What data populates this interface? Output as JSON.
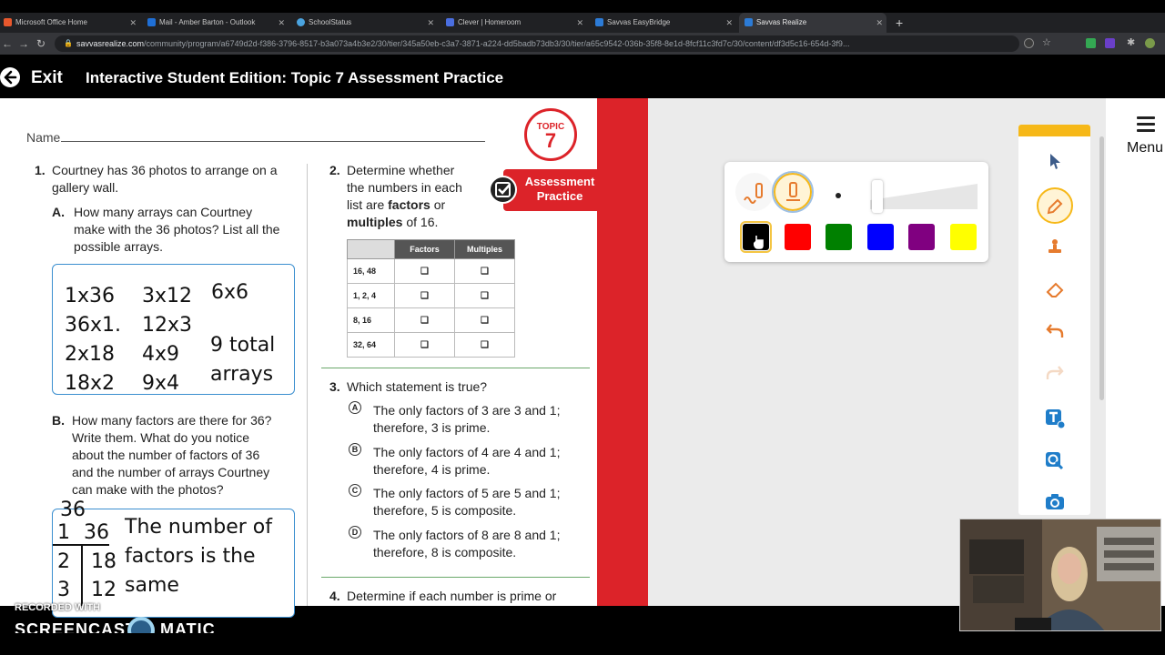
{
  "browser": {
    "tabs": [
      {
        "label": "Microsoft Office Home",
        "color": "#e8582d",
        "active": false
      },
      {
        "label": "Mail - Amber Barton - Outlook",
        "color": "#1f6fd6",
        "active": false
      },
      {
        "label": "SchoolStatus",
        "color": "#4aa3df",
        "active": false
      },
      {
        "label": "Clever | Homeroom",
        "color": "#4a6ee0",
        "active": false
      },
      {
        "label": "Savvas EasyBridge",
        "color": "#2c7bd6",
        "active": false
      },
      {
        "label": "Savvas Realize",
        "color": "#2c7bd6",
        "active": true
      }
    ],
    "new_tab": "+",
    "url_host": "savvasrealize.com",
    "url_path": "/community/program/a6749d2d-f386-3796-8517-b3a073a4b3e2/30/tier/345a50eb-c3a7-3871-a224-dd5badb73db3/30/tier/a65c9542-036b-35f8-8e1d-8fcf11c3fd7c/30/content/df3d5c16-654d-3f9..."
  },
  "header": {
    "exit_label": "Exit",
    "title": "Interactive Student Edition: Topic 7 Assessment Practice"
  },
  "doc": {
    "name_label": "Name",
    "topic_label": "TOPIC",
    "topic_number": "7",
    "assessment_line1": "Assessment",
    "assessment_line2": "Practice",
    "q1": {
      "number": "1.",
      "stem_line1": "Courtney has 36 photos to arrange on a",
      "stem_line2": "gallery wall.",
      "a_label": "A.",
      "a_line1": "How many arrays can Courtney",
      "a_line2": "make with the 36 photos? List all the",
      "a_line3": "possible arrays.",
      "answer": {
        "c1": [
          "1x36",
          "36x1.",
          "2x18",
          "18x2"
        ],
        "c2": [
          "3x12",
          "12x3",
          "4x9",
          "9x4"
        ],
        "c3": "6x6",
        "total_line1": "9 total",
        "total_line2": "arrays"
      },
      "b_label": "B.",
      "b_line1": "How many factors are there for 36?",
      "b_line2": "Write them. What do you notice",
      "b_line3": "about the number of factors of 36",
      "b_line4": "and the number of arrays Courtney",
      "b_line5": "can make with the photos?",
      "b_answer": {
        "top": "36",
        "rows": [
          [
            "1",
            "36"
          ],
          [
            "2",
            "18"
          ],
          [
            "3",
            "12"
          ]
        ],
        "text_line1": "The number of",
        "text_line2": "factors is the",
        "text_line3": "same"
      }
    },
    "q2": {
      "number": "2.",
      "line1": "Determine whether",
      "line2": "the numbers in each",
      "line3_pre": "list are ",
      "line3_bold": "factors",
      "line3_post": " or",
      "line4_bold": "multiples",
      "line4_post": " of 16.",
      "table": {
        "headers": [
          "Factors",
          "Multiples"
        ],
        "rows": [
          "16, 48",
          "1, 2, 4",
          "8, 16",
          "32, 64"
        ],
        "checkbox": "❑"
      }
    },
    "q3": {
      "number": "3.",
      "stem": "Which statement is true?",
      "options": [
        {
          "letter": "A",
          "line1": "The only factors of 3 are 3 and 1;",
          "line2": "therefore, 3 is prime."
        },
        {
          "letter": "B",
          "line1": "The only factors of 4 are 4 and 1;",
          "line2": "therefore, 4 is prime."
        },
        {
          "letter": "C",
          "line1": "The only factors of 5 are 5 and 1;",
          "line2": "therefore, 5 is composite."
        },
        {
          "letter": "D",
          "line1": "The only factors of 8 are 8 and 1;",
          "line2": "therefore, 8 is composite."
        }
      ]
    },
    "q4": {
      "number": "4.",
      "stem": "Determine if each number is prime or"
    }
  },
  "pen_panel": {
    "colors": [
      "#000000",
      "#ff0000",
      "#008000",
      "#0000ff",
      "#800080",
      "#ffff00"
    ],
    "selected_color_index": 0
  },
  "toolbar": {
    "tools": [
      "select-icon",
      "pen-icon",
      "stamp-icon",
      "eraser-icon",
      "undo-icon",
      "redo-icon",
      "text-icon",
      "zoom-icon",
      "camera-icon"
    ],
    "active_tool": "pen-icon"
  },
  "menu_label": "Menu",
  "watermark": {
    "line1": "RECORDED WITH",
    "line2a": "SCREENCAST",
    "line2b": "MATIC"
  }
}
